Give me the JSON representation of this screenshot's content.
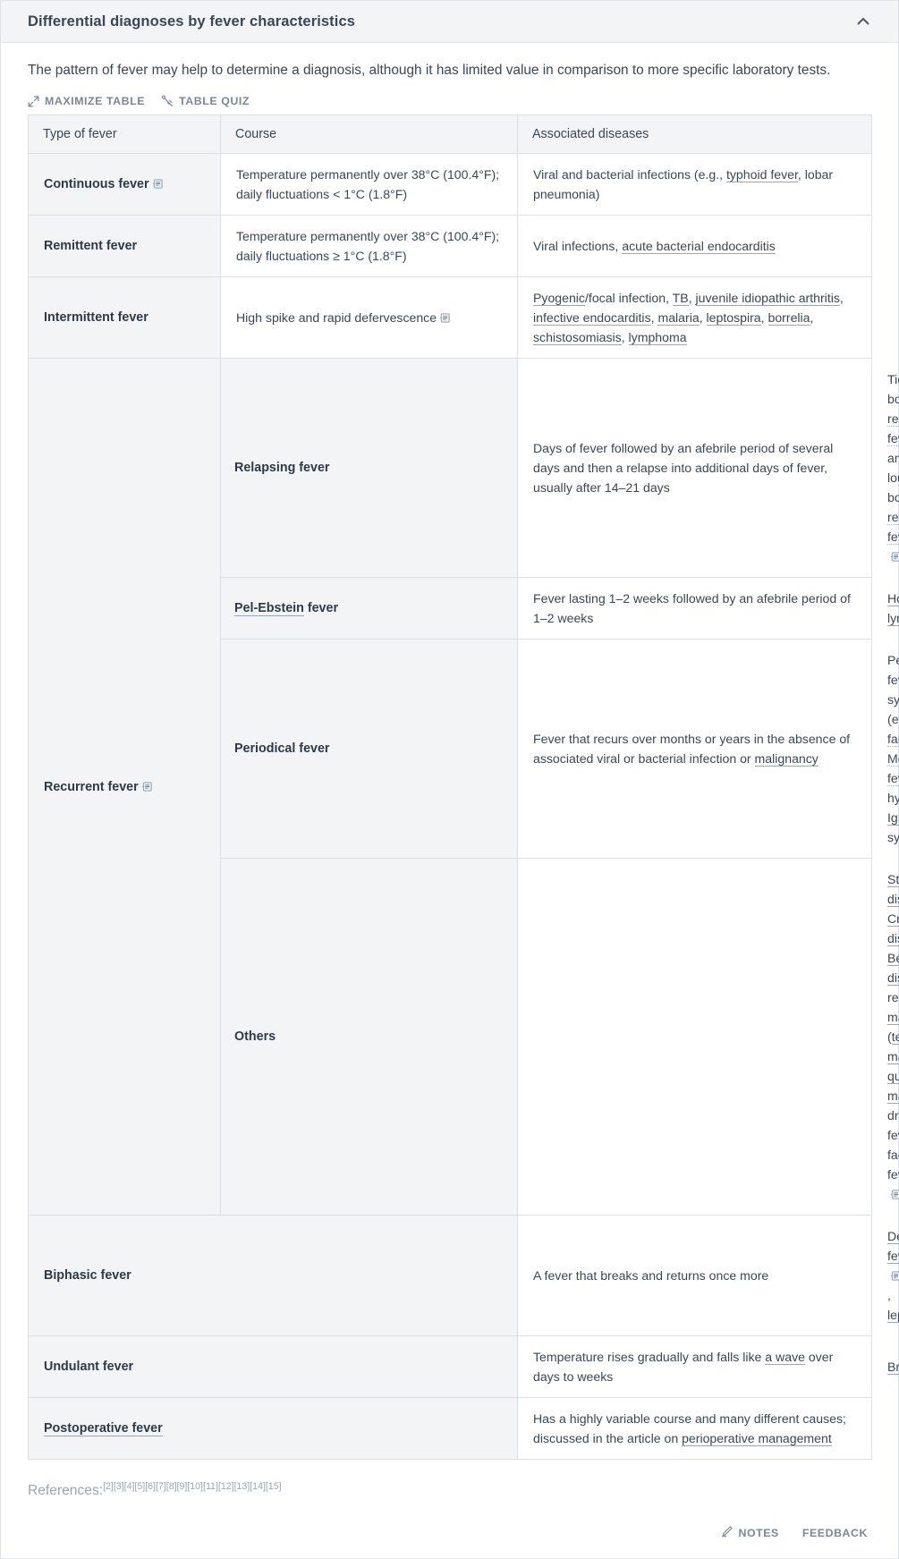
{
  "section": {
    "title": "Differential diagnoses by fever characteristics",
    "collapse_icon": "chevron-up-icon",
    "intro": "The pattern of fever may help to determine a diagnosis, although it has limited value in comparison to more specific laboratory tests."
  },
  "actions": {
    "maximize_label": "MAXIMIZE TABLE",
    "maximize_icon": "expand-arrows-icon",
    "quiz_label": "TABLE QUIZ",
    "quiz_icon": "quiz-tag-icon"
  },
  "table": {
    "headers": [
      "Type of fever",
      "Course",
      "Associated diseases"
    ],
    "rows": [
      {
        "type": "Continuous fever",
        "type_has_note": true,
        "course": "Temperature permanently over 38°C (100.4°F); daily fluctuations < 1°C (1.8°F)",
        "diseases": "Viral and bacterial infections (e.g., typhoid fever, lobar pneumonia)",
        "disease_links": [
          "typhoid fever"
        ]
      },
      {
        "type": "Remittent fever",
        "type_has_note": false,
        "course": "Temperature permanently over 38°C (100.4°F); daily fluctuations ≥ 1°C (1.8°F)",
        "diseases": "Viral infections, acute bacterial endocarditis",
        "disease_links": [
          "acute bacterial endocarditis"
        ]
      },
      {
        "type": "Intermittent fever",
        "type_has_note": false,
        "course": "High spike and rapid defervescence",
        "course_has_note": true,
        "diseases": "Pyogenic/focal infection, TB, juvenile idiopathic arthritis, infective endocarditis, malaria, leptospira, borrelia, schistosomiasis, lymphoma",
        "disease_links": [
          "Pyogenic",
          "TB",
          "juvenile idiopathic arthritis",
          "infective endocarditis",
          "malaria",
          "leptospira",
          "borrelia",
          "schistosomiasis",
          "lymphoma"
        ]
      }
    ],
    "recurrent_group": {
      "label": "Recurrent fever",
      "has_note": true,
      "subrows": [
        {
          "sub": "Relapsing fever",
          "sub_link": false,
          "course": "Days of fever followed by an afebrile period of several days and then a relapse into additional days of fever, usually after 14–21 days",
          "diseases": "Tick-borne relapsing fever and louse-borne relapsing fever",
          "diseases_has_note": true
        },
        {
          "sub": "Pel-Ebstein fever",
          "sub_link": true,
          "course": "Fever lasting 1–2 weeks followed by an afebrile period of 1–2 weeks",
          "diseases": "Hodgkin lymphoma"
        },
        {
          "sub": "Periodical fever",
          "sub_link": false,
          "course": "Fever that recurs over months or years in the absence of associated viral or bacterial infection or malignancy",
          "diseases": "Periodic fever syndromes (e.g., familial Mediterranean fever, hyper-IgD syndrome)"
        },
        {
          "sub": "Others",
          "sub_link": false,
          "course": "",
          "diseases": "Still disease, Crohn disease, Behcet disease, relapsing malaria (tertian malaria, quartan malaria), drug fever, factitious fever",
          "diseases_has_note": true
        }
      ]
    },
    "rows_tail": [
      {
        "type": "Biphasic fever",
        "course": "A fever that breaks and returns once more",
        "diseases": "Dengue fever, leptospirosis"
      },
      {
        "type": "Undulant fever",
        "course": "Temperature rises gradually and falls like a wave over days to weeks",
        "diseases": "Brucellosis"
      }
    ],
    "last_row": {
      "type": "Postoperative fever",
      "type_link": true,
      "text": "Has a highly variable course and many different causes; discussed in the article on perioperative management",
      "text_link": "perioperative management"
    }
  },
  "references": {
    "label": "References:",
    "items": [
      "[2]",
      "[3]",
      "[4]",
      "[5]",
      "[6]",
      "[7]",
      "[8]",
      "[9]",
      "[10]",
      "[11]",
      "[12]",
      "[13]",
      "[14]",
      "[15]"
    ]
  },
  "footer": {
    "notes_label": "NOTES",
    "notes_icon": "pencil-icon",
    "feedback_label": "FEEDBACK"
  },
  "colors": {
    "header_bg": "#f2f4f5",
    "text": "#3b4754",
    "muted": "#7b8794",
    "border": "#dcdfe3"
  }
}
